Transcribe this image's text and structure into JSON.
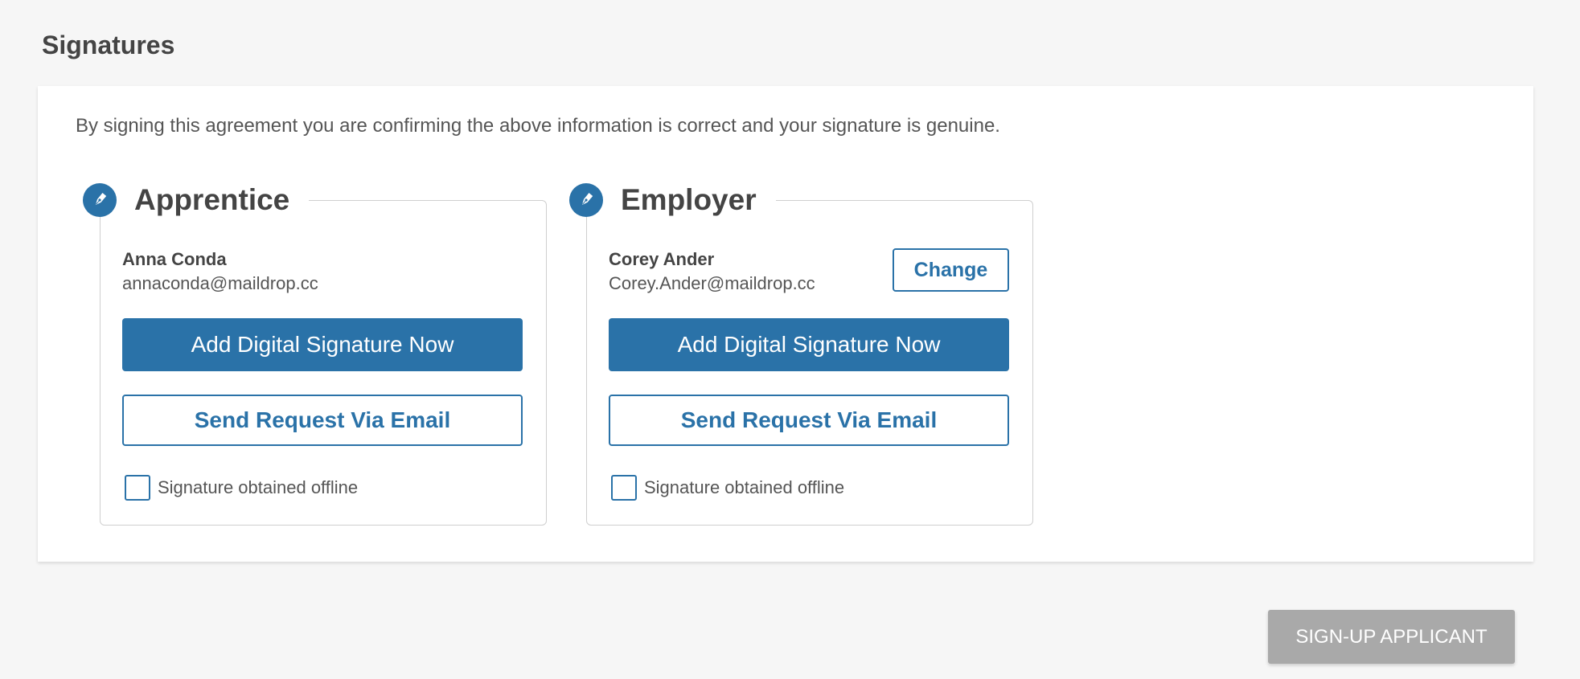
{
  "page": {
    "title": "Signatures",
    "intro": "By signing this agreement you are confirming the above information is correct and your signature is genuine."
  },
  "colors": {
    "primary": "#2a72a8",
    "disabled_button": "#a9a9a9",
    "background": "#f6f6f6"
  },
  "signatories": [
    {
      "role": "Apprentice",
      "icon": "pen-icon",
      "name": "Anna Conda",
      "email": "annaconda@maildrop.cc",
      "add_signature_label": "Add Digital Signature Now",
      "send_request_label": "Send Request Via Email",
      "offline_label": "Signature obtained offline",
      "offline_checked": false
    },
    {
      "role": "Employer",
      "icon": "pen-icon",
      "name": "Corey Ander",
      "email": "Corey.Ander@maildrop.cc",
      "change_label": "Change",
      "add_signature_label": "Add Digital Signature Now",
      "send_request_label": "Send Request Via Email",
      "offline_label": "Signature obtained offline",
      "offline_checked": false
    }
  ],
  "footer": {
    "submit_label": "SIGN-UP APPLICANT",
    "submit_enabled": false
  }
}
